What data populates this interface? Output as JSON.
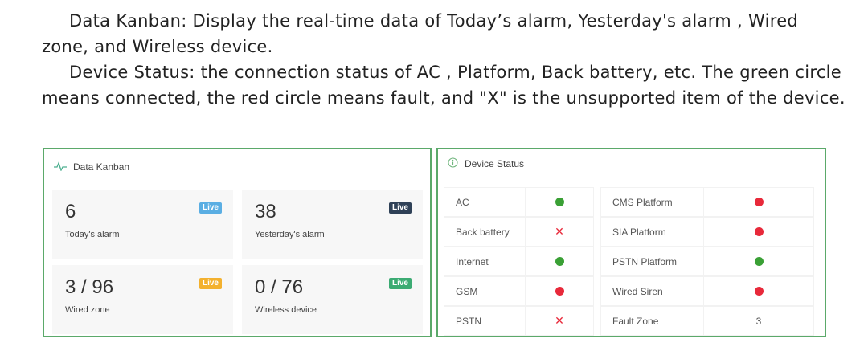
{
  "intro": {
    "paragraph1": "Data Kanban: Display the real-time data of Today’s  alarm, Yesterday's alarm , Wired zone, and Wireless device.",
    "paragraph2": "Device Status: the connection status of AC , Platform, Back  battery, etc. The green circle means  connected, the red circle means fault, and \"X\" is the unsupported item of the device."
  },
  "kanban": {
    "title": "Data Kanban",
    "icon": "pulse-icon",
    "cards": [
      {
        "value": "6",
        "label": "Today's alarm",
        "badge": "Live",
        "badge_color": "#5aaee3"
      },
      {
        "value": "38",
        "label": "Yesterday's alarm",
        "badge": "Live",
        "badge_color": "#2f4157"
      },
      {
        "value": "3 / 96",
        "label": "Wired zone",
        "badge": "Live",
        "badge_color": "#f3b12f"
      },
      {
        "value": "0 / 76",
        "label": "Wireless device",
        "badge": "Live",
        "badge_color": "#3cab73"
      }
    ]
  },
  "status": {
    "title": "Device Status",
    "icon": "info-icon",
    "left": [
      {
        "name": "AC",
        "state": "green"
      },
      {
        "name": "Back battery",
        "state": "x"
      },
      {
        "name": "Internet",
        "state": "green"
      },
      {
        "name": "GSM",
        "state": "red"
      },
      {
        "name": "PSTN",
        "state": "x"
      }
    ],
    "right": [
      {
        "name": "CMS Platform",
        "state": "red"
      },
      {
        "name": "SIA Platform",
        "state": "red"
      },
      {
        "name": "PSTN Platform",
        "state": "green"
      },
      {
        "name": "Wired Siren",
        "state": "red"
      },
      {
        "name": "Fault Zone",
        "state": "text",
        "text": "3"
      }
    ],
    "x_glyph": "✕",
    "colors": {
      "green": "#3aa035",
      "red": "#e8293a"
    }
  }
}
